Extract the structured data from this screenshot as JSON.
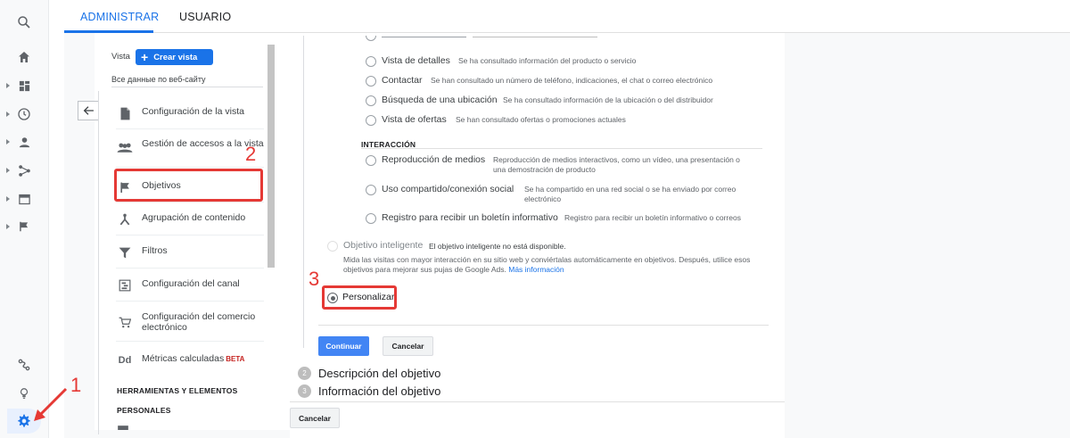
{
  "tabs": {
    "admin": "ADMINISTRAR",
    "user": "USUARIO"
  },
  "view_selector": {
    "label": "Vista",
    "create_button": "Crear vista",
    "view_name": "Все данные по веб-сайту"
  },
  "menu": {
    "items": [
      {
        "label": "Configuración de la vista",
        "icon": "document-icon"
      },
      {
        "label": "Gestión de accesos a la vista",
        "icon": "people-icon"
      },
      {
        "label": "Objetivos",
        "icon": "flag-icon"
      },
      {
        "label": "Agrupación de contenido",
        "icon": "branch-icon"
      },
      {
        "label": "Filtros",
        "icon": "filter-icon"
      },
      {
        "label": "Configuración del canal",
        "icon": "channel-icon"
      },
      {
        "label": "Configuración del comercio electrónico",
        "icon": "cart-icon"
      },
      {
        "label": "Métricas calculadas",
        "icon": "dd-icon",
        "badge": "BETA"
      }
    ],
    "section_tools": "HERRAMIENTAS Y ELEMENTOS",
    "section_personal": "PERSONALES",
    "dd_glyph": "Dd"
  },
  "goals": {
    "engagement_options": [
      {
        "title": "Vista de detalles",
        "desc": "Se ha consultado información del producto o servicio"
      },
      {
        "title": "Contactar",
        "desc": "Se han consultado un número de teléfono, indicaciones, el chat o correo electrónico"
      },
      {
        "title": "Búsqueda de una ubicación",
        "desc": "Se ha consultado información de la ubicación o del distribuidor"
      },
      {
        "title": "Vista de ofertas",
        "desc": "Se han consultado ofertas o promociones actuales"
      }
    ],
    "interaction_title": "INTERACCIÓN",
    "interaction_options": [
      {
        "title": "Reproducción de medios",
        "desc": "Reproducción de medios interactivos, como un vídeo, una presentación o una demostración de producto"
      },
      {
        "title": "Uso compartido/conexión social",
        "desc": "Se ha compartido en una red social o se ha enviado por correo electrónico"
      },
      {
        "title": "Registro para recibir un boletín informativo",
        "desc": "Registro para recibir un boletín informativo o correos"
      }
    ],
    "smart_goal": {
      "title": "Objetivo inteligente",
      "note": "El objetivo inteligente no está disponible.",
      "desc": "Mida las visitas con mayor interacción en su sitio web y conviértalas automáticamente en objetivos. Después, utilice esos objetivos para mejorar sus pujas de Google Ads.",
      "link": "Más información"
    },
    "custom_label": "Personalizar",
    "continue_button": "Continuar",
    "cancel_button": "Cancelar",
    "steps": [
      {
        "num": "2",
        "title": "Descripción del objetivo"
      },
      {
        "num": "3",
        "title": "Información del objetivo"
      }
    ],
    "bottom_cancel": "Cancelar"
  },
  "annotations": {
    "a1": "1",
    "a2": "2",
    "a3": "3"
  },
  "colors": {
    "accent": "#1a73e8",
    "annotation": "#e53935"
  }
}
